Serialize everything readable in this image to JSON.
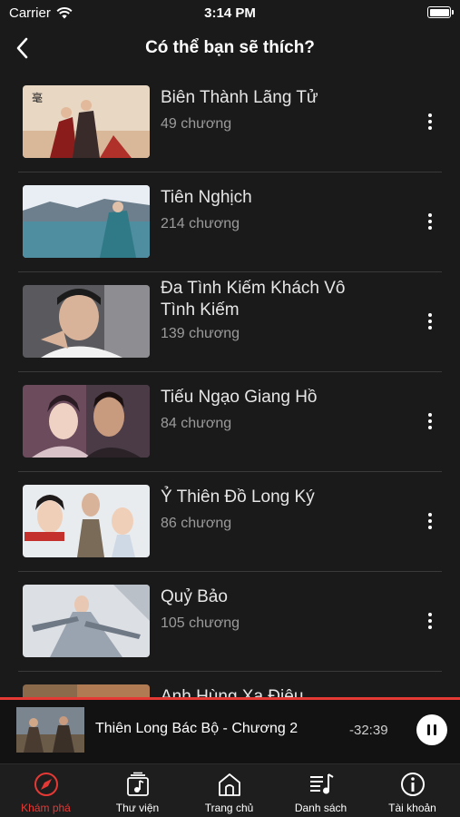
{
  "status_bar": {
    "carrier": "Carrier",
    "time": "3:14 PM"
  },
  "nav": {
    "title": "Có thể bạn sẽ thích?"
  },
  "items": [
    {
      "title": "Biên Thành Lãng Tử",
      "chapters": "49 chương"
    },
    {
      "title": "Tiên Nghịch",
      "chapters": "214 chương"
    },
    {
      "title": "Đa Tình Kiếm Khách Vô Tình Kiếm",
      "chapters": "139 chương"
    },
    {
      "title": "Tiếu Ngạo Giang Hồ",
      "chapters": "84 chương"
    },
    {
      "title": "Ỷ Thiên Đồ Long Ký",
      "chapters": "86 chương"
    },
    {
      "title": "Quỷ Bảo",
      "chapters": "105 chương"
    },
    {
      "title": "Anh Hùng Xạ Điêu",
      "chapters": ""
    }
  ],
  "player": {
    "title": "Thiên Long Bác Bộ - Chương 2",
    "remaining": "-32:39",
    "progress_fraction": 1.0
  },
  "tabs": [
    {
      "label": "Khám phá",
      "icon": "compass-icon",
      "active": true
    },
    {
      "label": "Thư viện",
      "icon": "library-icon",
      "active": false
    },
    {
      "label": "Trang chủ",
      "icon": "home-icon",
      "active": false
    },
    {
      "label": "Danh sách",
      "icon": "playlist-icon",
      "active": false
    },
    {
      "label": "Tài khoản",
      "icon": "info-icon",
      "active": false
    }
  ],
  "colors": {
    "accent": "#e53935",
    "background": "#1a1a1a",
    "tab_bar": "#1e1e1e"
  }
}
